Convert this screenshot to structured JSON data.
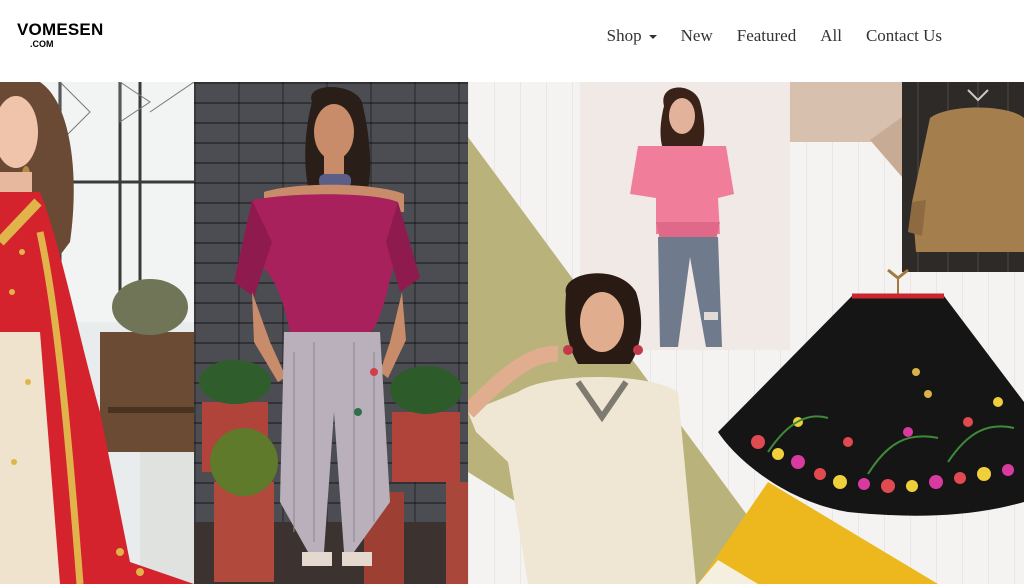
{
  "brand": {
    "name": "VOMESEN",
    "suffix": ".COM"
  },
  "nav": {
    "shop": "Shop",
    "new": "New",
    "featured": "Featured",
    "all": "All",
    "contact": "Contact Us"
  },
  "colors": {
    "olive": "#b9b27a",
    "gold": "#ecb81e",
    "pink_top": "#f07e9a",
    "magenta_top": "#a8205c",
    "saree_red": "#d4232d"
  }
}
